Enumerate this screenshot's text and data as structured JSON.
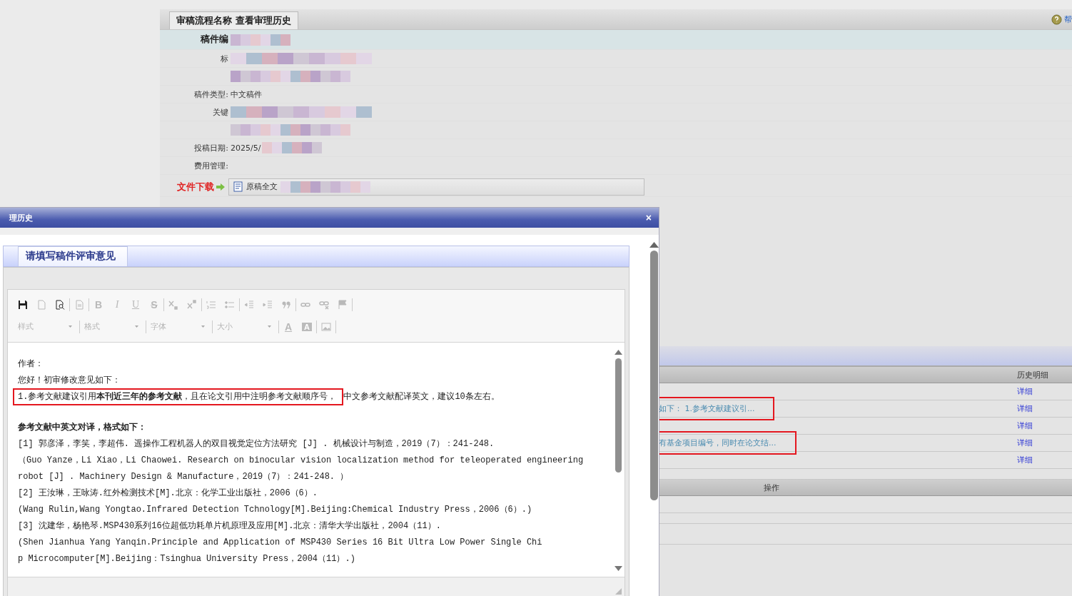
{
  "page_header": {
    "tab": "审稿流程名称 查看审理历史",
    "help_link": "帮"
  },
  "details": [
    {
      "label": "稿件编",
      "redacted": true,
      "emphasis": true,
      "kind": "field"
    },
    {
      "label": "标",
      "redacted": true,
      "emphasis": false,
      "kind": "field"
    },
    {
      "redacted": true,
      "emphasis": false,
      "kind": "field"
    },
    {
      "label": "稿件类型:",
      "value": "中文稿件",
      "redacted": false,
      "emphasis": false,
      "kind": "field"
    },
    {
      "label": "关键",
      "redacted": true,
      "emphasis": false,
      "kind": "field"
    },
    {
      "redacted": true,
      "emphasis": false,
      "kind": "field"
    },
    {
      "label": "投稿日期:",
      "value": "2025/5/",
      "redacted": true,
      "emphasis": false,
      "kind": "field"
    },
    {
      "label": "费用管理:",
      "redacted": false,
      "emphasis": false,
      "kind": "field"
    },
    {
      "label": "文件下载",
      "value": "原稿全文",
      "redacted": true,
      "emphasis": false,
      "kind": "download"
    }
  ],
  "history_table": {
    "detail_column": "历史明细",
    "rows": [
      {
        "link": "详细",
        "highlighted": false
      },
      {
        "summary": "如下：  1.参考文献建议引...",
        "link": "详细",
        "highlighted": true
      },
      {
        "link": "详细",
        "highlighted": false
      },
      {
        "summary": "有基金项目编号，同时在论文结...",
        "link": "详细",
        "highlighted": true
      },
      {
        "link": "详细",
        "highlighted": false
      }
    ],
    "action_column": "操作"
  },
  "dialog": {
    "title": "理历史",
    "close": "×",
    "tab": {
      "label": "请填写稿件评审意见",
      "selected": true
    },
    "toolbar_rows": [
      [
        [
          {
            "kind": "icon",
            "disabled": false
          },
          {
            "kind": "icon",
            "disabled": true
          },
          {
            "kind": "icon",
            "disabled": false
          }
        ],
        [
          {
            "kind": "icon",
            "disabled": true
          }
        ],
        [
          {
            "kind": "text",
            "label": "B",
            "disabled": true
          },
          {
            "kind": "text",
            "label": "I",
            "disabled": true
          },
          {
            "kind": "text",
            "label": "U",
            "disabled": true
          },
          {
            "kind": "text",
            "label": "S",
            "disabled": true
          }
        ],
        [
          {
            "kind": "icon",
            "disabled": true
          },
          {
            "kind": "icon",
            "disabled": true
          }
        ],
        [
          {
            "kind": "icon",
            "disabled": true
          },
          {
            "kind": "icon",
            "disabled": true
          }
        ],
        [
          {
            "kind": "icon",
            "disabled": true
          },
          {
            "kind": "icon",
            "disabled": true
          },
          {
            "kind": "icon",
            "disabled": true
          }
        ],
        [
          {
            "kind": "icon",
            "disabled": true
          },
          {
            "kind": "icon",
            "disabled": true
          },
          {
            "kind": "icon",
            "disabled": true
          }
        ]
      ],
      [
        [
          {
            "kind": "dropdown",
            "label": "样式",
            "disabled": true
          }
        ],
        [
          {
            "kind": "dropdown",
            "label": "格式",
            "disabled": true
          }
        ],
        [
          {
            "kind": "dropdown",
            "label": "字体",
            "disabled": true
          }
        ],
        [
          {
            "kind": "dropdown",
            "label": "大小",
            "disabled": true
          }
        ],
        [
          {
            "kind": "text",
            "label": "A",
            "disabled": true
          },
          {
            "kind": "text",
            "label": "A",
            "disabled": true
          }
        ],
        [
          {
            "kind": "icon",
            "disabled": true
          }
        ]
      ]
    ],
    "lines": [
      {
        "kind": "plain",
        "text": "作者："
      },
      {
        "kind": "plain",
        "text": "您好！初审修改意见如下："
      },
      {
        "kind": "highlight",
        "text": "1.参考文献建议引用**本刊近三年的参考文献**，且在论文引用中注明参考文献顺序号，",
        "rest": "中文参考文献配译英文，建议10条左右。"
      },
      {
        "kind": "heading",
        "text": "参考文献中英文对译，格式如下："
      },
      {
        "kind": "plain",
        "text": "[1] 郭彦泽，李笑，李超伟. 遥操作工程机器人的双目视觉定位方法研究 [J] . 机械设计与制造，2019（7）：241-248."
      },
      {
        "kind": "plain",
        "text": "（Guo Yanze，Li Xiao，Li Chaowei. Research on binocular vision localization method for teleoperated engineering"
      },
      {
        "kind": "plain",
        "text": "robot [J] . Machinery Design & Manufacture，2019（7）：241-248. ）"
      },
      {
        "kind": "plain",
        "text": "[2] 王汝琳，王咏涛.红外检测技术[M].北京：化学工业出版社，2006（6）."
      },
      {
        "kind": "plain",
        "text": "(Wang Rulin,Wang Yongtao.Infrared Detection Tchnology[M].Beijing:Chemical Industry Press，2006（6）.)"
      },
      {
        "kind": "plain",
        "text": "[3] 沈建华，杨艳琴.MSP430系列16位超低功耗单片机原理及应用[M].北京：清华大学出版社，2004（11）."
      },
      {
        "kind": "plain",
        "text": "(Shen Jianhua Yang Yanqin.Principle and Application of MSP430 Series 16 Bit Ultra Low Power Single Chi"
      },
      {
        "kind": "plain",
        "text": "p Microcomputer[M].Beijing：Tsinghua University Press，2004（11）.)"
      }
    ]
  }
}
